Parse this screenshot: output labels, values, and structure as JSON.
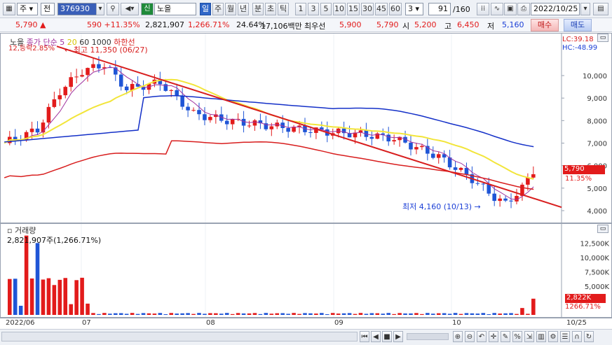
{
  "toolbar": {
    "market": "주",
    "scope": "전",
    "code": "376930",
    "name_badge": "신",
    "name": "노을",
    "periods": [
      "일",
      "주",
      "월",
      "년",
      "분",
      "초",
      "틱"
    ],
    "minutes": [
      "1",
      "3",
      "5",
      "10",
      "15",
      "30",
      "45",
      "60"
    ],
    "interval_value": "3",
    "page": "91",
    "page_total": "/160",
    "date": "2022/10/25"
  },
  "info": {
    "price": "5,790",
    "change": "590",
    "change_pct": "+11.35%",
    "volume": "2,821,907",
    "volume_pct": "1,266.71%",
    "turnover_pct": "24.64%",
    "amount": "17,106백만",
    "best_ask_label": "최우선",
    "best_ask": "5,900",
    "best_bid": "5,790",
    "open_label": "시",
    "open": "5,200",
    "high_label": "고",
    "high": "6,450",
    "low_label": "저",
    "low": "5,160",
    "buy": "매수",
    "sell": "매도"
  },
  "price_pane": {
    "legend": {
      "prefix_cut": "노을",
      "ma_label": "종가 단순 5",
      "ma_20": "20",
      "ma_60": "60",
      "ma_1000": "1000",
      "env": "하한선",
      "overlay": "12,등락2.85%"
    },
    "high_note": "최고 11,350 (06/27)",
    "low_note": "최저 4,160 (10/13)",
    "lc": "LC:39.18",
    "hc": "HC:-48.99",
    "last_price_tag": "5,790",
    "last_pct_tag": "11.35%",
    "y_ticks": [
      "10,000",
      "9,000",
      "8,000",
      "7,000",
      "6,000",
      "5,000",
      "4,000"
    ]
  },
  "volume_pane": {
    "title": "거래량",
    "value": "2,821,907주(1,266.71%)",
    "y_ticks": [
      "12,500K",
      "10,000K",
      "7,500K",
      "5,000K"
    ],
    "last_tag": "2,822K",
    "last_pct": "1266.71%"
  },
  "x_axis": {
    "labels": [
      "2022/06",
      "07",
      "08",
      "09",
      "10"
    ],
    "right_label": "10/25"
  },
  "colors": {
    "up": "#e21b1b",
    "down": "#1f55d6",
    "ma5": "#a0329f",
    "ma20": "#f2e53a",
    "ma60": "#1430c8",
    "envelope": "#d81e1e"
  }
}
